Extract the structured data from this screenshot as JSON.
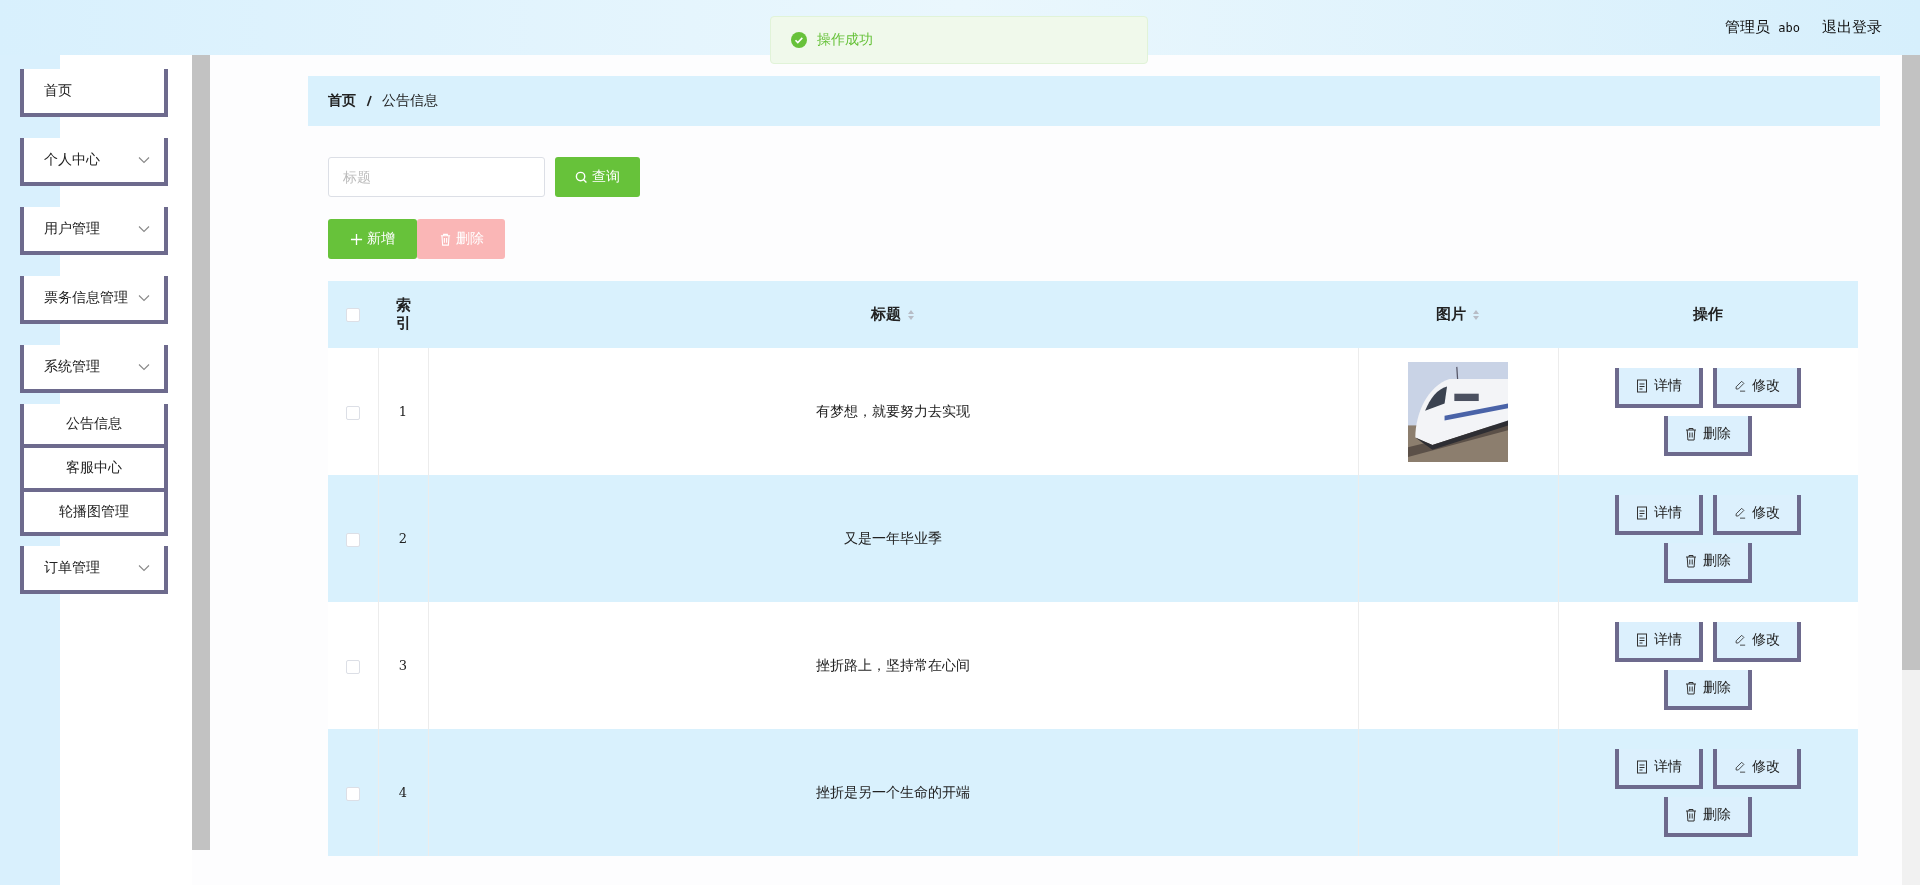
{
  "header": {
    "user_role": "管理员",
    "username": "abo",
    "logout": "退出登录"
  },
  "toast": {
    "message": "操作成功"
  },
  "sidebar": {
    "items": [
      {
        "label": "首页",
        "kind": "link"
      },
      {
        "label": "个人中心",
        "kind": "group"
      },
      {
        "label": "用户管理",
        "kind": "group"
      },
      {
        "label": "票务信息管理",
        "kind": "group"
      },
      {
        "label": "系统管理",
        "kind": "group",
        "children": [
          {
            "label": "公告信息"
          },
          {
            "label": "客服中心"
          },
          {
            "label": "轮播图管理"
          }
        ]
      },
      {
        "label": "订单管理",
        "kind": "group"
      }
    ]
  },
  "breadcrumb": [
    "首页",
    "公告信息"
  ],
  "search": {
    "placeholder": "标题",
    "button": "查询"
  },
  "actions": {
    "add": "新增",
    "delete": "删除",
    "delete_disabled": true
  },
  "table": {
    "columns": [
      {
        "label": "索引",
        "kind": "plain"
      },
      {
        "label": "标题",
        "kind": "sortable"
      },
      {
        "label": "图片",
        "kind": "sortable"
      },
      {
        "label": "操作",
        "kind": "plain"
      }
    ],
    "all_checked": false,
    "rows": [
      {
        "index": "1",
        "title": "有梦想，就要努力去实现",
        "checked": false,
        "image": {
          "kind": "picture"
        },
        "buttons": [
          "详情",
          "修改",
          "删除"
        ]
      },
      {
        "index": "2",
        "title": "又是一年毕业季",
        "checked": false,
        "buttons": [
          "详情",
          "修改",
          "删除"
        ]
      },
      {
        "index": "3",
        "title": "挫折路上，坚持常在心间",
        "checked": false,
        "buttons": [
          "详情",
          "修改",
          "删除"
        ]
      },
      {
        "index": "4",
        "title": "挫折是另一个生命的开端",
        "checked": false,
        "buttons": [
          "详情",
          "修改",
          "删除"
        ]
      }
    ]
  }
}
